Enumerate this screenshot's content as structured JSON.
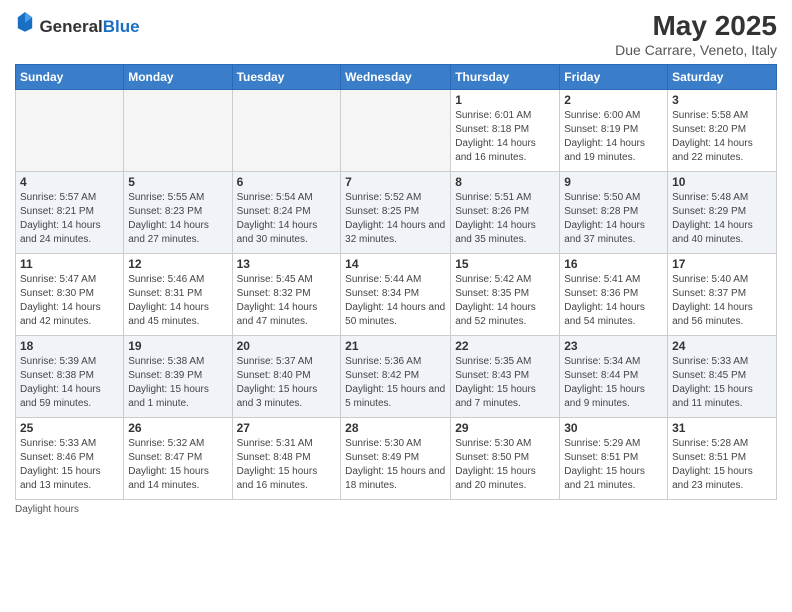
{
  "header": {
    "logo_general": "General",
    "logo_blue": "Blue",
    "month_year": "May 2025",
    "location": "Due Carrare, Veneto, Italy"
  },
  "days_of_week": [
    "Sunday",
    "Monday",
    "Tuesday",
    "Wednesday",
    "Thursday",
    "Friday",
    "Saturday"
  ],
  "weeks": [
    [
      {
        "day": "",
        "info": ""
      },
      {
        "day": "",
        "info": ""
      },
      {
        "day": "",
        "info": ""
      },
      {
        "day": "",
        "info": ""
      },
      {
        "day": "1",
        "sunrise": "6:01 AM",
        "sunset": "8:18 PM",
        "daylight": "14 hours and 16 minutes."
      },
      {
        "day": "2",
        "sunrise": "6:00 AM",
        "sunset": "8:19 PM",
        "daylight": "14 hours and 19 minutes."
      },
      {
        "day": "3",
        "sunrise": "5:58 AM",
        "sunset": "8:20 PM",
        "daylight": "14 hours and 22 minutes."
      }
    ],
    [
      {
        "day": "4",
        "sunrise": "5:57 AM",
        "sunset": "8:21 PM",
        "daylight": "14 hours and 24 minutes."
      },
      {
        "day": "5",
        "sunrise": "5:55 AM",
        "sunset": "8:23 PM",
        "daylight": "14 hours and 27 minutes."
      },
      {
        "day": "6",
        "sunrise": "5:54 AM",
        "sunset": "8:24 PM",
        "daylight": "14 hours and 30 minutes."
      },
      {
        "day": "7",
        "sunrise": "5:52 AM",
        "sunset": "8:25 PM",
        "daylight": "14 hours and 32 minutes."
      },
      {
        "day": "8",
        "sunrise": "5:51 AM",
        "sunset": "8:26 PM",
        "daylight": "14 hours and 35 minutes."
      },
      {
        "day": "9",
        "sunrise": "5:50 AM",
        "sunset": "8:28 PM",
        "daylight": "14 hours and 37 minutes."
      },
      {
        "day": "10",
        "sunrise": "5:48 AM",
        "sunset": "8:29 PM",
        "daylight": "14 hours and 40 minutes."
      }
    ],
    [
      {
        "day": "11",
        "sunrise": "5:47 AM",
        "sunset": "8:30 PM",
        "daylight": "14 hours and 42 minutes."
      },
      {
        "day": "12",
        "sunrise": "5:46 AM",
        "sunset": "8:31 PM",
        "daylight": "14 hours and 45 minutes."
      },
      {
        "day": "13",
        "sunrise": "5:45 AM",
        "sunset": "8:32 PM",
        "daylight": "14 hours and 47 minutes."
      },
      {
        "day": "14",
        "sunrise": "5:44 AM",
        "sunset": "8:34 PM",
        "daylight": "14 hours and 50 minutes."
      },
      {
        "day": "15",
        "sunrise": "5:42 AM",
        "sunset": "8:35 PM",
        "daylight": "14 hours and 52 minutes."
      },
      {
        "day": "16",
        "sunrise": "5:41 AM",
        "sunset": "8:36 PM",
        "daylight": "14 hours and 54 minutes."
      },
      {
        "day": "17",
        "sunrise": "5:40 AM",
        "sunset": "8:37 PM",
        "daylight": "14 hours and 56 minutes."
      }
    ],
    [
      {
        "day": "18",
        "sunrise": "5:39 AM",
        "sunset": "8:38 PM",
        "daylight": "14 hours and 59 minutes."
      },
      {
        "day": "19",
        "sunrise": "5:38 AM",
        "sunset": "8:39 PM",
        "daylight": "15 hours and 1 minute."
      },
      {
        "day": "20",
        "sunrise": "5:37 AM",
        "sunset": "8:40 PM",
        "daylight": "15 hours and 3 minutes."
      },
      {
        "day": "21",
        "sunrise": "5:36 AM",
        "sunset": "8:42 PM",
        "daylight": "15 hours and 5 minutes."
      },
      {
        "day": "22",
        "sunrise": "5:35 AM",
        "sunset": "8:43 PM",
        "daylight": "15 hours and 7 minutes."
      },
      {
        "day": "23",
        "sunrise": "5:34 AM",
        "sunset": "8:44 PM",
        "daylight": "15 hours and 9 minutes."
      },
      {
        "day": "24",
        "sunrise": "5:33 AM",
        "sunset": "8:45 PM",
        "daylight": "15 hours and 11 minutes."
      }
    ],
    [
      {
        "day": "25",
        "sunrise": "5:33 AM",
        "sunset": "8:46 PM",
        "daylight": "15 hours and 13 minutes."
      },
      {
        "day": "26",
        "sunrise": "5:32 AM",
        "sunset": "8:47 PM",
        "daylight": "15 hours and 14 minutes."
      },
      {
        "day": "27",
        "sunrise": "5:31 AM",
        "sunset": "8:48 PM",
        "daylight": "15 hours and 16 minutes."
      },
      {
        "day": "28",
        "sunrise": "5:30 AM",
        "sunset": "8:49 PM",
        "daylight": "15 hours and 18 minutes."
      },
      {
        "day": "29",
        "sunrise": "5:30 AM",
        "sunset": "8:50 PM",
        "daylight": "15 hours and 20 minutes."
      },
      {
        "day": "30",
        "sunrise": "5:29 AM",
        "sunset": "8:51 PM",
        "daylight": "15 hours and 21 minutes."
      },
      {
        "day": "31",
        "sunrise": "5:28 AM",
        "sunset": "8:51 PM",
        "daylight": "15 hours and 23 minutes."
      }
    ]
  ],
  "footer": "Daylight hours"
}
